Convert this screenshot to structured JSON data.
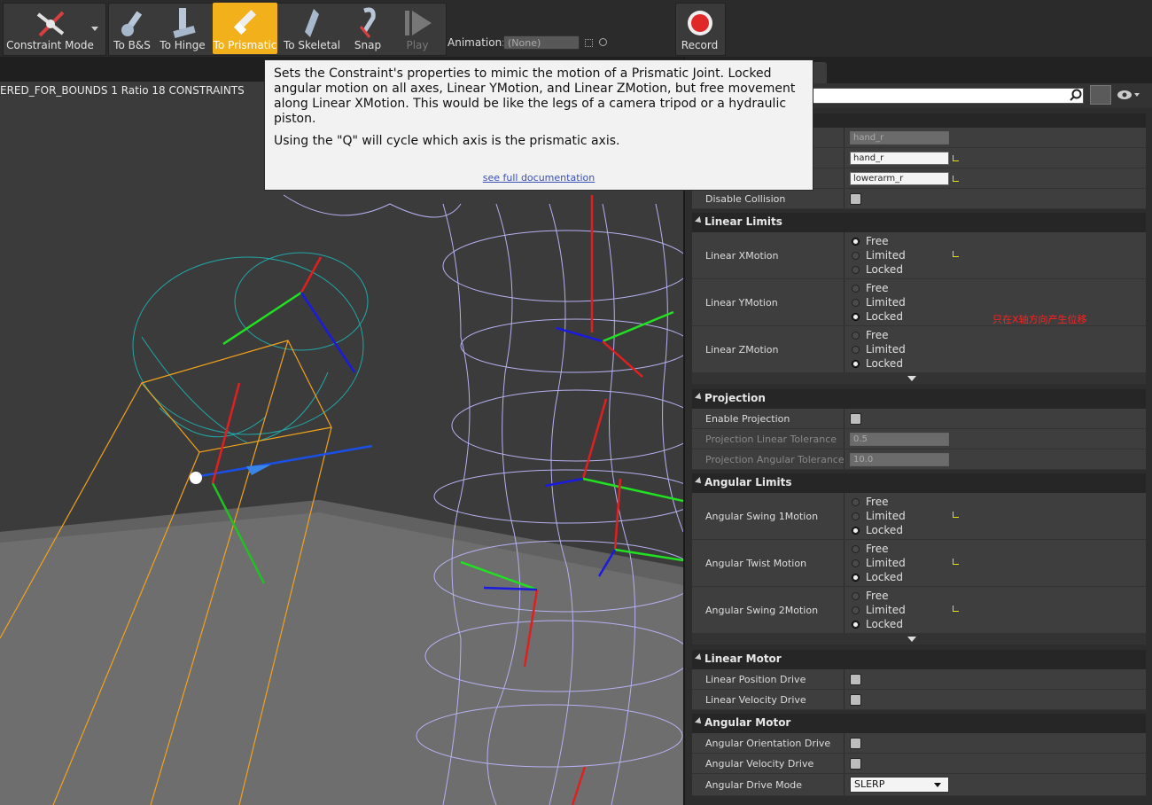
{
  "toolbar": {
    "buttons": [
      {
        "label": "Constraint Mode"
      },
      {
        "label": "To B&S"
      },
      {
        "label": "To Hinge"
      },
      {
        "label": "To Prismatic"
      },
      {
        "label": "To Skeletal"
      },
      {
        "label": "Snap"
      },
      {
        "label": "Play"
      },
      {
        "label": "Record"
      }
    ],
    "animation_label": "Animation:",
    "animation_value": "(None)",
    "active_color": "#f2b11b"
  },
  "viewport": {
    "info": "ERED_FOR_BOUNDS  1 Ratio  18 CONSTRAINTS"
  },
  "tooltip": {
    "p1": "Sets the Constraint's properties to mimic the motion of a Prismatic Joint. Locked angular motion on all axes, Linear YMotion, and Linear ZMotion, but free movement along Linear XMotion. This would be like the legs of a camera tripod or a hydraulic piston.",
    "p2": "Using the \"Q\" will cycle which axis is the prismatic axis.",
    "doc_link": "see full documentation"
  },
  "details": {
    "fields": {
      "joint_name": "hand_r",
      "bone1": "hand_r",
      "bone2": "lowerarm_r"
    },
    "disable_collision": "Disable Collision",
    "linear_limits": {
      "title": "Linear Limits",
      "rows": [
        {
          "name": "Linear XMotion",
          "options": [
            "Free",
            "Limited",
            "Locked"
          ],
          "selected": 0
        },
        {
          "name": "Linear YMotion",
          "options": [
            "Free",
            "Limited",
            "Locked"
          ],
          "selected": 2
        },
        {
          "name": "Linear ZMotion",
          "options": [
            "Free",
            "Limited",
            "Locked"
          ],
          "selected": 2
        }
      ],
      "note": "只在X轴方向产生位移"
    },
    "projection": {
      "title": "Projection",
      "enable": "Enable Projection",
      "linear_tol_label": "Projection Linear Tolerance",
      "linear_tol": "0.5",
      "angular_tol_label": "Projection Angular Tolerance",
      "angular_tol": "10.0"
    },
    "angular_limits": {
      "title": "Angular Limits",
      "rows": [
        {
          "name": "Angular Swing 1Motion",
          "options": [
            "Free",
            "Limited",
            "Locked"
          ],
          "selected": 2
        },
        {
          "name": "Angular Twist Motion",
          "options": [
            "Free",
            "Limited",
            "Locked"
          ],
          "selected": 2
        },
        {
          "name": "Angular Swing 2Motion",
          "options": [
            "Free",
            "Limited",
            "Locked"
          ],
          "selected": 2
        }
      ]
    },
    "linear_motor": {
      "title": "Linear Motor",
      "position": "Linear Position Drive",
      "velocity": "Linear Velocity Drive"
    },
    "angular_motor": {
      "title": "Angular Motor",
      "orientation": "Angular Orientation Drive",
      "velocity": "Angular Velocity Drive",
      "mode_label": "Angular Drive Mode",
      "mode_value": "SLERP"
    }
  }
}
